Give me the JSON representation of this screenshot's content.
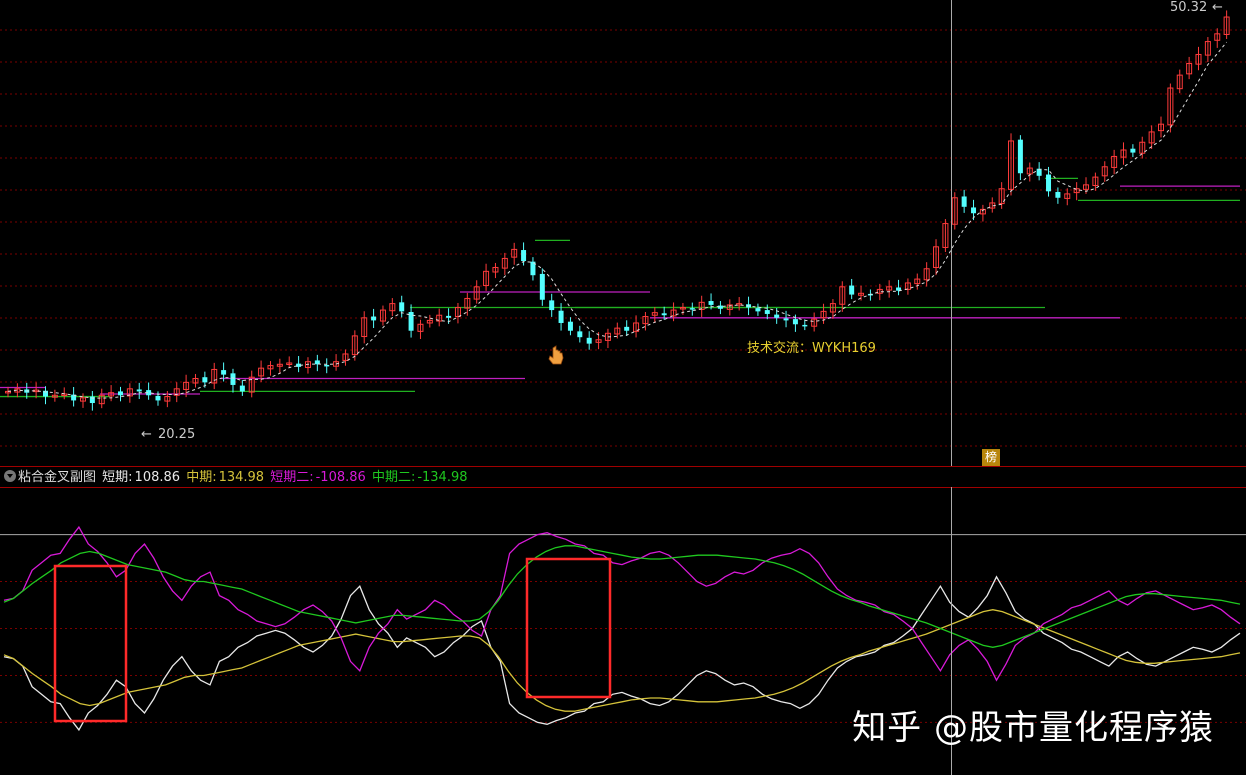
{
  "colors": {
    "background": "#000000",
    "grid": "#7a0000",
    "up_candle": "#ff3b3b",
    "down_candle": "#54ffff",
    "short_line": "#e8e8e8",
    "mid_line": "#d4c23a",
    "short2_line": "#d81ad8",
    "mid2_line": "#1fc81f",
    "highlight_box": "#ff2a2a",
    "level_purple": "#c020c0",
    "level_green": "#20b020"
  },
  "main_panel": {
    "max_label": "50.32",
    "min_label": "20.25",
    "annotation": "技术交流：WYKH169",
    "rank_badge": "榜"
  },
  "indicator": {
    "title": "粘合金叉副图",
    "short_label": "短期:",
    "short_value": "108.86",
    "mid_label": "中期:",
    "mid_value": "134.98",
    "short2_label": "短期二:",
    "short2_value": "-108.86",
    "mid2_label": "中期二:",
    "mid2_value": "-134.98"
  },
  "watermark": "知乎 @股市量化程序猿",
  "chart_data": [
    {
      "type": "candlestick",
      "title": "",
      "ylim": [
        18,
        51
      ],
      "annotated_high": 50.32,
      "annotated_low": 20.25,
      "closes": [
        21.3,
        21.5,
        21.2,
        21.4,
        20.9,
        21.0,
        21.1,
        20.6,
        20.8,
        20.4,
        21.0,
        21.2,
        21.0,
        21.5,
        21.3,
        21.0,
        20.6,
        20.9,
        21.5,
        22.0,
        22.3,
        22.0,
        23.0,
        22.6,
        21.8,
        21.3,
        22.4,
        23.1,
        23.3,
        23.4,
        23.5,
        23.2,
        23.6,
        23.4,
        23.3,
        23.6,
        24.2,
        25.6,
        27.0,
        26.8,
        27.6,
        28.1,
        27.5,
        26.0,
        26.5,
        26.8,
        27.2,
        27.0,
        27.8,
        28.5,
        29.4,
        30.6,
        30.9,
        31.6,
        32.3,
        31.4,
        30.3,
        28.4,
        27.6,
        26.6,
        26.0,
        25.5,
        25.0,
        25.3,
        25.8,
        26.2,
        26.0,
        26.6,
        27.1,
        27.4,
        27.2,
        27.6,
        27.8,
        27.7,
        28.2,
        28.0,
        27.7,
        28.0,
        28.1,
        27.8,
        27.5,
        27.3,
        27.0,
        26.8,
        26.5,
        26.4,
        26.9,
        27.5,
        28.1,
        29.4,
        28.8,
        28.9,
        28.8,
        29.2,
        29.4,
        29.1,
        29.7,
        30.0,
        30.8,
        32.5,
        34.3,
        36.3,
        35.6,
        35.1,
        35.4,
        35.9,
        37.0,
        40.7,
        38.2,
        38.6,
        38.0,
        36.8,
        36.3,
        36.6,
        37.0,
        37.3,
        37.9,
        38.7,
        39.5,
        40.0,
        39.8,
        40.6,
        41.4,
        42.0,
        44.8,
        45.8,
        46.7,
        47.4,
        48.4,
        49.0,
        50.3
      ]
    },
    {
      "type": "line",
      "title": "粘合金叉副图",
      "series": [
        {
          "name": "短期",
          "values": [
            -30,
            -32,
            -40,
            -62,
            -70,
            -78,
            -80,
            -95,
            -108,
            -90,
            -82,
            -70,
            -55,
            -62,
            -80,
            -90,
            -75,
            -55,
            -40,
            -30,
            -45,
            -55,
            -60,
            -35,
            -30,
            -20,
            -15,
            -8,
            -5,
            -2,
            -5,
            -12,
            -20,
            -25,
            -18,
            -8,
            10,
            35,
            45,
            20,
            5,
            -5,
            -20,
            -10,
            -15,
            -20,
            -30,
            -25,
            -15,
            -8,
            2,
            8,
            -20,
            -35,
            -80,
            -90,
            -95,
            -100,
            -102,
            -98,
            -95,
            -90,
            -88,
            -80,
            -78,
            -70,
            -68,
            -72,
            -75,
            -80,
            -82,
            -78,
            -70,
            -60,
            -50,
            -45,
            -48,
            -55,
            -60,
            -58,
            -62,
            -70,
            -75,
            -78,
            -80,
            -85,
            -80,
            -70,
            -55,
            -42,
            -35,
            -30,
            -28,
            -25,
            -18,
            -15,
            -8,
            0,
            15,
            30,
            45,
            28,
            18,
            12,
            22,
            35,
            55,
            38,
            18,
            10,
            5,
            -5,
            -10,
            -15,
            -22,
            -25,
            -30,
            -35,
            -40,
            -30,
            -25,
            -32,
            -38,
            -40,
            -35,
            -30,
            -25,
            -20,
            -22,
            -25,
            -20,
            -12,
            -5
          ]
        },
        {
          "name": "中期",
          "values": [
            -28,
            -32,
            -40,
            -48,
            -55,
            -62,
            -70,
            -75,
            -80,
            -82,
            -80,
            -76,
            -72,
            -68,
            -66,
            -64,
            -62,
            -60,
            -56,
            -52,
            -50,
            -50,
            -48,
            -46,
            -44,
            -42,
            -38,
            -34,
            -30,
            -26,
            -22,
            -18,
            -16,
            -14,
            -12,
            -10,
            -8,
            -6,
            -8,
            -10,
            -12,
            -14,
            -14,
            -13,
            -12,
            -11,
            -10,
            -9,
            -8,
            -8,
            -10,
            -18,
            -30,
            -45,
            -58,
            -68,
            -76,
            -82,
            -86,
            -88,
            -88,
            -86,
            -84,
            -82,
            -80,
            -78,
            -76,
            -75,
            -74,
            -74,
            -75,
            -76,
            -77,
            -78,
            -78,
            -78,
            -77,
            -76,
            -75,
            -74,
            -72,
            -70,
            -67,
            -63,
            -58,
            -52,
            -46,
            -40,
            -35,
            -31,
            -28,
            -24,
            -21,
            -18,
            -15,
            -12,
            -9,
            -6,
            -2,
            2,
            6,
            10,
            14,
            18,
            20,
            18,
            14,
            10,
            6,
            2,
            -2,
            -6,
            -10,
            -14,
            -18,
            -22,
            -26,
            -30,
            -34,
            -36,
            -37,
            -37,
            -36,
            -35,
            -34,
            -33,
            -32,
            -31,
            -30,
            -28,
            -26
          ]
        },
        {
          "name": "短期二",
          "values": [
            30,
            32,
            40,
            62,
            70,
            78,
            80,
            95,
            108,
            90,
            82,
            70,
            55,
            62,
            80,
            90,
            75,
            55,
            40,
            30,
            45,
            55,
            60,
            35,
            30,
            20,
            15,
            8,
            5,
            2,
            5,
            12,
            20,
            25,
            18,
            8,
            -10,
            -35,
            -45,
            -20,
            -5,
            5,
            20,
            10,
            15,
            20,
            30,
            25,
            15,
            8,
            -2,
            -8,
            20,
            35,
            80,
            90,
            95,
            100,
            102,
            98,
            95,
            90,
            88,
            80,
            78,
            70,
            68,
            72,
            75,
            80,
            82,
            78,
            70,
            60,
            50,
            45,
            48,
            55,
            60,
            58,
            62,
            70,
            75,
            78,
            80,
            85,
            80,
            70,
            55,
            42,
            35,
            30,
            28,
            25,
            18,
            15,
            8,
            0,
            -15,
            -30,
            -45,
            -28,
            -18,
            -12,
            -22,
            -35,
            -55,
            -38,
            -18,
            -10,
            -5,
            5,
            10,
            15,
            22,
            25,
            30,
            35,
            40,
            30,
            25,
            32,
            38,
            40,
            35,
            30,
            25,
            20,
            22,
            25,
            20,
            12,
            5
          ]
        },
        {
          "name": "中期二",
          "values": [
            28,
            32,
            40,
            48,
            55,
            62,
            70,
            75,
            80,
            82,
            80,
            76,
            72,
            68,
            66,
            64,
            62,
            60,
            56,
            52,
            50,
            50,
            48,
            46,
            44,
            42,
            38,
            34,
            30,
            26,
            22,
            18,
            16,
            14,
            12,
            10,
            8,
            6,
            8,
            10,
            12,
            14,
            14,
            13,
            12,
            11,
            10,
            9,
            8,
            8,
            10,
            18,
            30,
            45,
            58,
            68,
            76,
            82,
            86,
            88,
            88,
            86,
            84,
            82,
            80,
            78,
            76,
            75,
            74,
            74,
            75,
            76,
            77,
            78,
            78,
            78,
            77,
            76,
            75,
            74,
            72,
            70,
            67,
            63,
            58,
            52,
            46,
            40,
            35,
            31,
            28,
            24,
            21,
            18,
            15,
            12,
            9,
            6,
            2,
            -2,
            -6,
            -10,
            -14,
            -18,
            -20,
            -18,
            -14,
            -10,
            -6,
            -2,
            2,
            6,
            10,
            14,
            18,
            22,
            26,
            30,
            34,
            36,
            37,
            37,
            36,
            35,
            34,
            33,
            32,
            31,
            30,
            28,
            26
          ]
        }
      ],
      "ylim": [
        -140,
        140
      ],
      "last_values": {
        "短期": 108.86,
        "中期": 134.98,
        "短期二": -108.86,
        "中期二": -134.98
      }
    }
  ]
}
